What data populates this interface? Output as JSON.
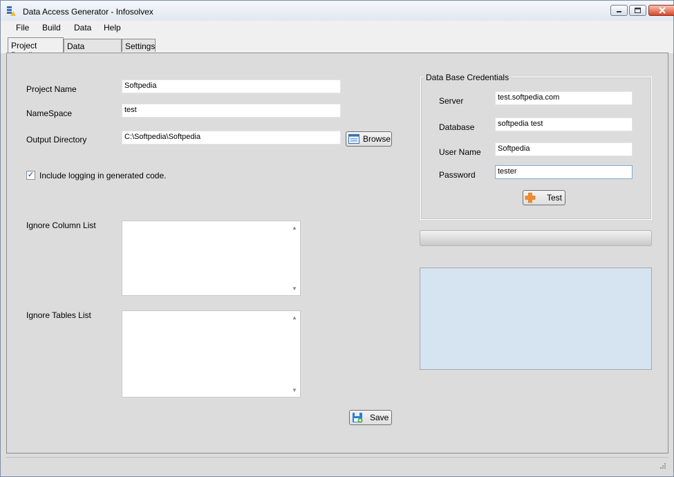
{
  "window": {
    "title": "Data Access Generator - Infosolvex"
  },
  "menu": {
    "items": [
      "File",
      "Build",
      "Data",
      "Help"
    ]
  },
  "tabs": [
    "Project Details",
    "Data Generator",
    "Settings"
  ],
  "project": {
    "project_name_label": "Project Name",
    "project_name_value": "Softpedia",
    "namespace_label": "NameSpace",
    "namespace_value": "test",
    "output_dir_label": "Output Directory",
    "output_dir_value": "C:\\Softpedia\\Softpedia",
    "browse_label": "Browse",
    "logging_label": "Include logging in generated code.",
    "logging_checked": true,
    "ignore_column_label": "Ignore Column List",
    "ignore_tables_label": "Ignore Tables List",
    "save_label": "Save"
  },
  "credentials": {
    "group_title": "Data Base Credentials",
    "server_label": "Server",
    "server_value": "test.softpedia.com",
    "database_label": "Database",
    "database_value": "softpedia test",
    "username_label": "User Name",
    "username_value": "Softpedia",
    "password_label": "Password",
    "password_value": "tester",
    "test_label": "Test"
  },
  "progress": {
    "value": 0
  },
  "colors": {
    "output_panel": "#d6e3f0",
    "test_icon": "#f28c28",
    "save_icon": "#2a7fd4"
  },
  "icons": {
    "app": "database-icon",
    "browse": "folder-window-icon",
    "test": "plus-icon",
    "save": "floppy-disk-icon"
  }
}
